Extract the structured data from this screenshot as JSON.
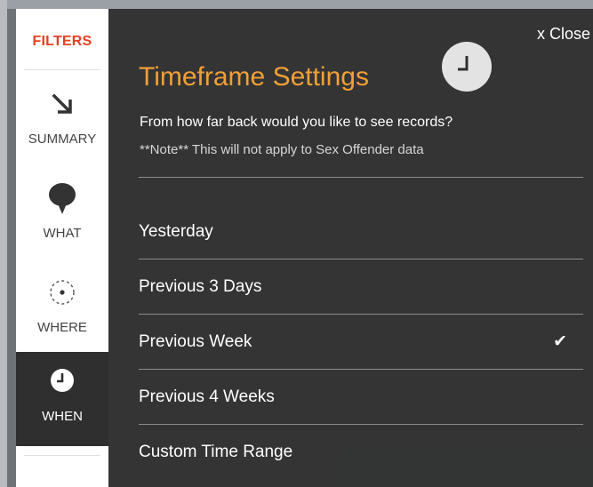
{
  "sidebar": {
    "filters_label": "FILTERS",
    "items": [
      {
        "label": "SUMMARY",
        "icon": "arrow-down-right-icon"
      },
      {
        "label": "WHAT",
        "icon": "speech-bubble-icon"
      },
      {
        "label": "WHERE",
        "icon": "location-target-icon"
      },
      {
        "label": "WHEN",
        "icon": "clock-icon",
        "active": true
      }
    ]
  },
  "panel": {
    "close_label": "x Close",
    "title": "Timeframe Settings",
    "question": "From how far back would you like to see records?",
    "note": "**Note** This will not apply to Sex Offender data",
    "options": [
      {
        "label": "Yesterday",
        "selected": false
      },
      {
        "label": "Previous 3 Days",
        "selected": false
      },
      {
        "label": "Previous Week",
        "selected": true,
        "check": "✔"
      },
      {
        "label": "Previous 4 Weeks",
        "selected": false
      },
      {
        "label": "Custom Time Range",
        "selected": false
      }
    ]
  },
  "colors": {
    "accent_red": "#e8401f",
    "title_orange": "#f1a035",
    "panel_bg": "#2f2f2f"
  }
}
